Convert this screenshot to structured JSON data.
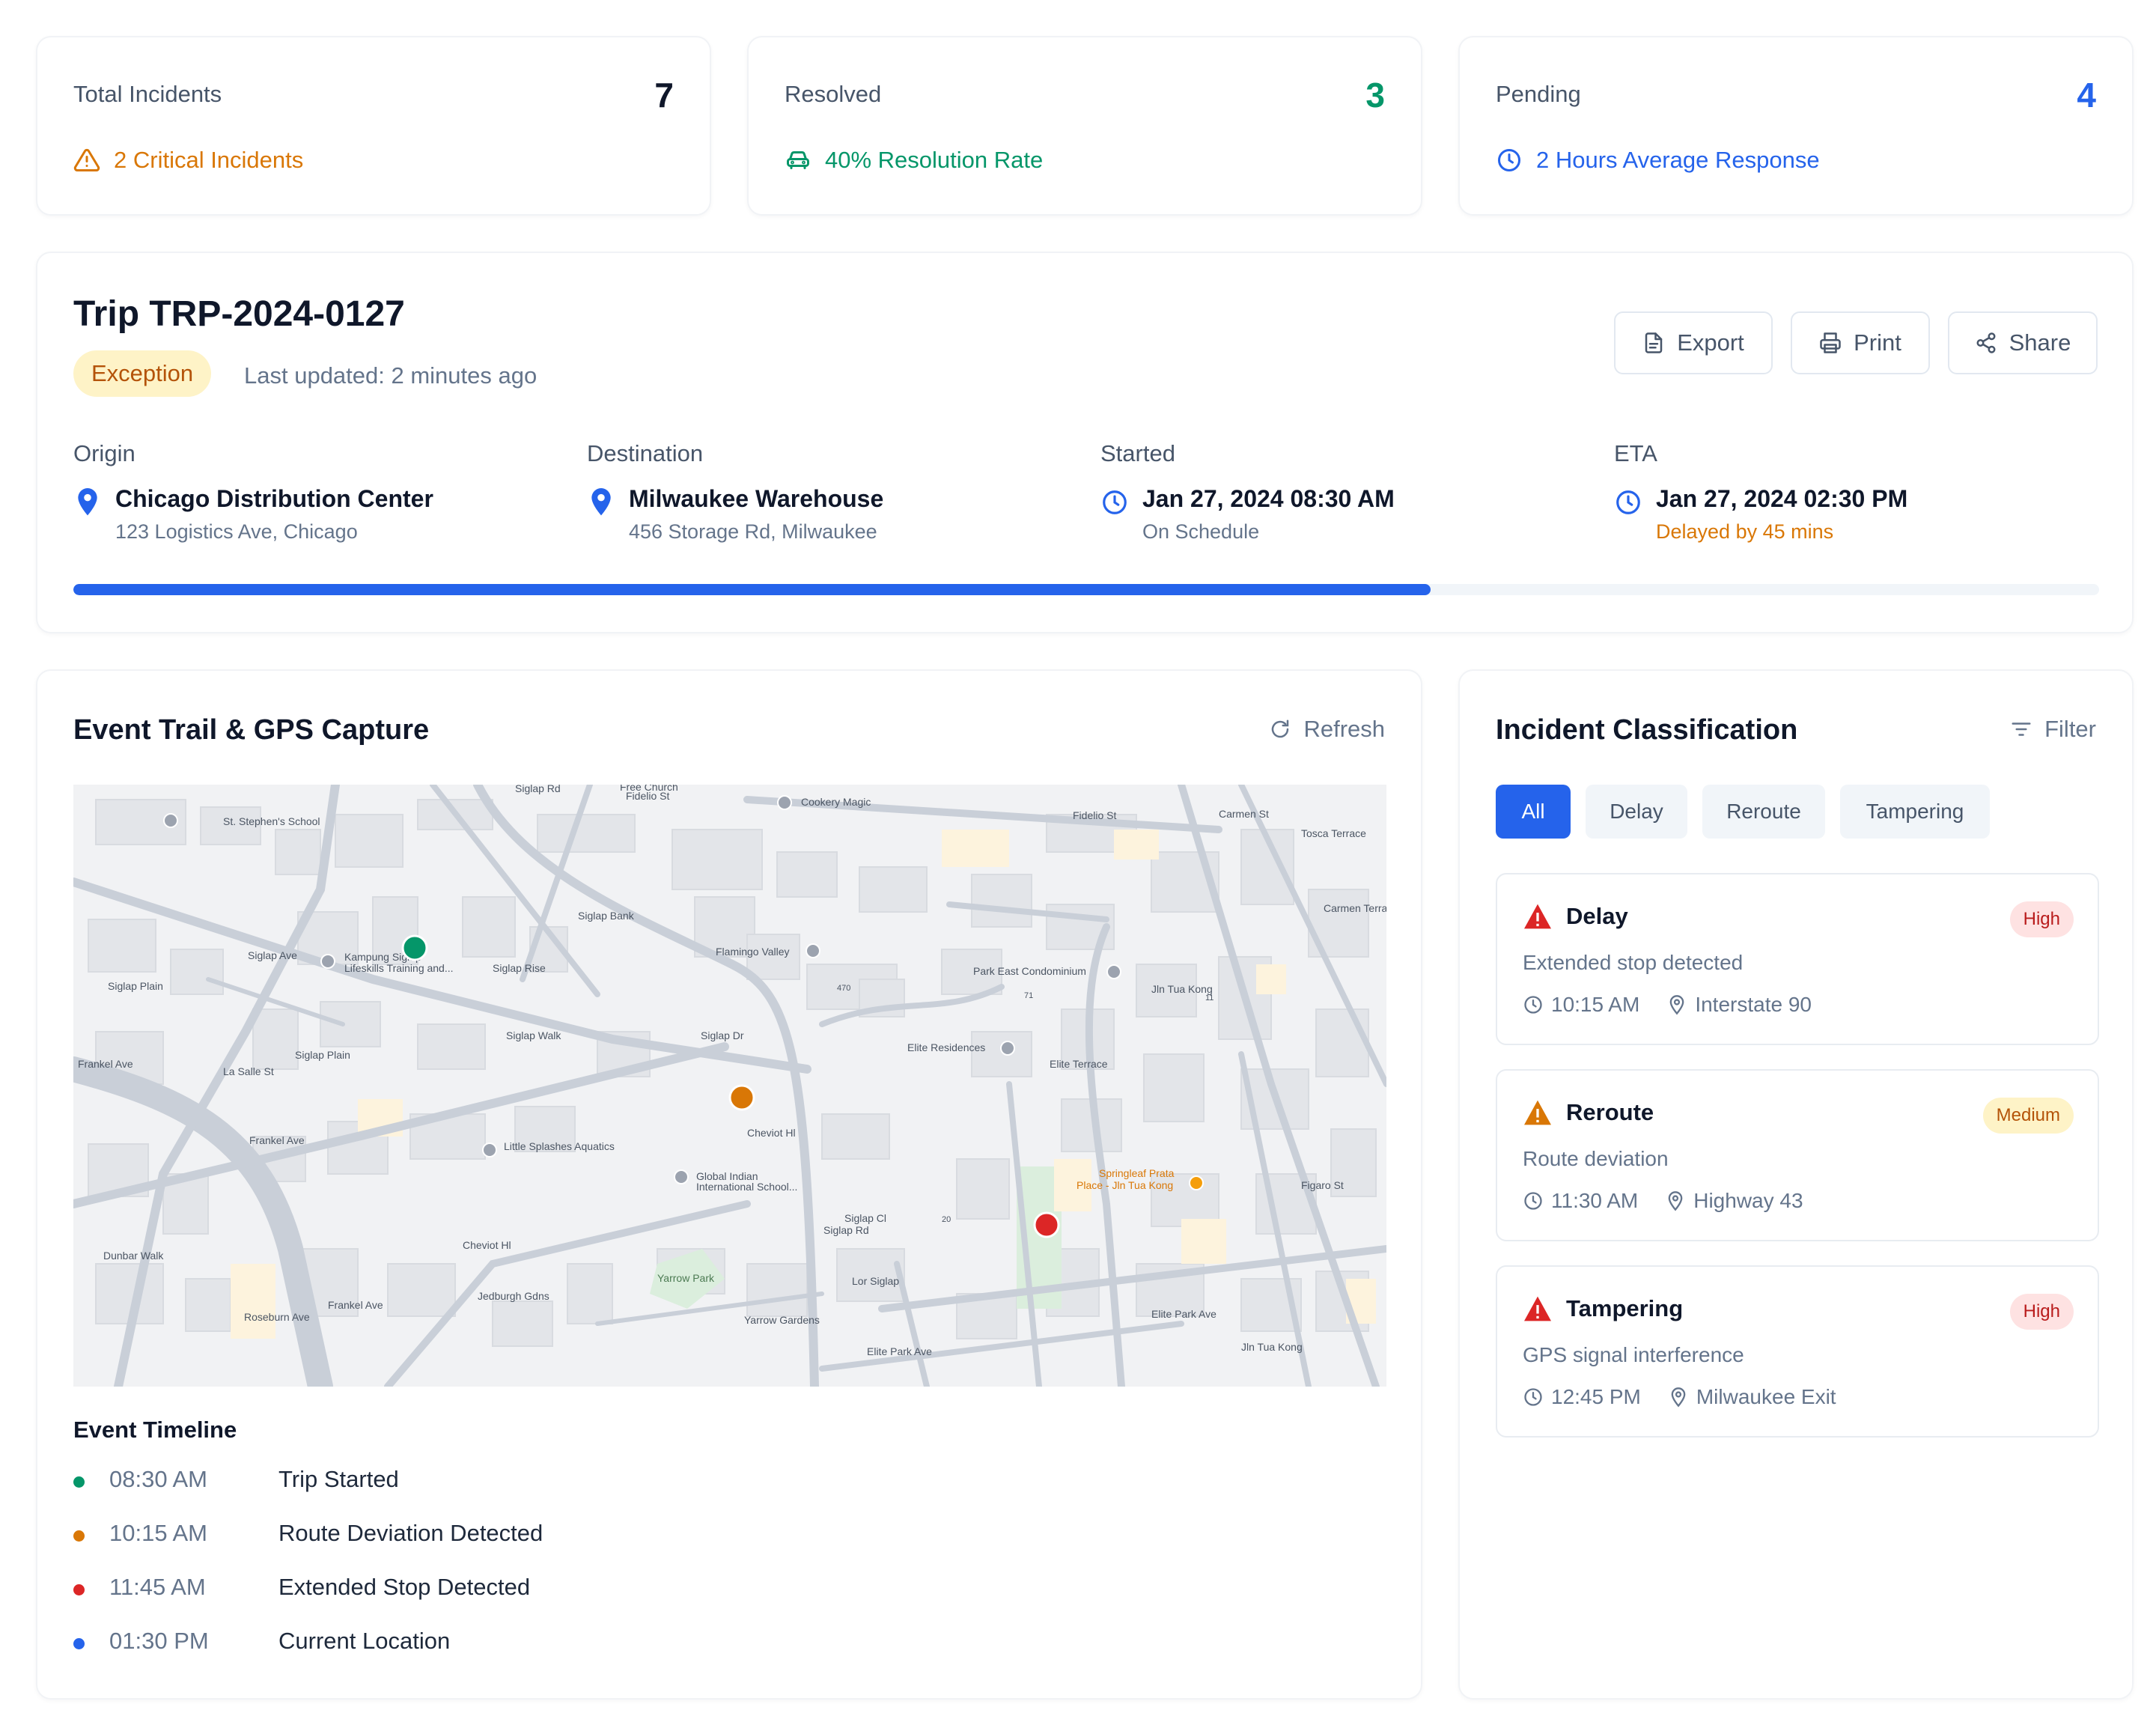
{
  "kpis": {
    "total": {
      "label": "Total Incidents",
      "value": "7",
      "sub": "2 Critical Incidents",
      "color": "#0f172a",
      "sub_color": "#d97706",
      "icon": "warning-triangle-icon"
    },
    "resolved": {
      "label": "Resolved",
      "value": "3",
      "sub": "40% Resolution Rate",
      "color": "#059669",
      "sub_color": "#059669",
      "icon": "car-icon"
    },
    "pending": {
      "label": "Pending",
      "value": "4",
      "sub": "2 Hours Average Response",
      "color": "#2563eb",
      "sub_color": "#2563eb",
      "icon": "clock-icon"
    }
  },
  "trip": {
    "title": "Trip TRP-2024-0127",
    "status": "Exception",
    "last_updated": "Last updated: 2 minutes ago",
    "buttons": {
      "export": "Export",
      "print": "Print",
      "share": "Share"
    },
    "origin": {
      "label": "Origin",
      "name": "Chicago Distribution Center",
      "sub": "123 Logistics Ave, Chicago"
    },
    "destination": {
      "label": "Destination",
      "name": "Milwaukee Warehouse",
      "sub": "456 Storage Rd, Milwaukee"
    },
    "started": {
      "label": "Started",
      "value": "Jan 27, 2024 08:30 AM",
      "sub": "On Schedule"
    },
    "eta": {
      "label": "ETA",
      "value": "Jan 27, 2024 02:30 PM",
      "sub": "Delayed by 45 mins"
    },
    "progress_percent": 67
  },
  "event_trail": {
    "title": "Event Trail & GPS Capture",
    "refresh": "Refresh",
    "map_labels": {
      "free_church": "Free Church",
      "cookery_magic": "Cookery Magic",
      "st_stephens": "St. Stephen's School",
      "fidelio_st": "Fidelio St",
      "fidelio_st_2": "Fidelio St",
      "siglap_rd": "Siglap Rd",
      "siglap_rd_2": "Siglap Rd",
      "siglap_ave": "Siglap Ave",
      "siglap_plain": "Siglap Plain",
      "siglap_plain_2": "Siglap Plain",
      "kampung_1": "Kampung Siglap",
      "kampung_2": "Lifeskills Training and...",
      "flamingo": "Flamingo Valley",
      "park_east": "Park East Condominium",
      "elite_res": "Elite Residences",
      "frankel_ave": "Frankel Ave",
      "frankel_ave_2": "Frankel Ave",
      "frankel_ave_3": "Frankel Ave",
      "la_salle": "La Salle St",
      "little_splashes": "Little Splashes Aquatics",
      "global_indian_1": "Global Indian",
      "global_indian_2": "International School...",
      "springleaf_1": "Springleaf Prata",
      "springleaf_2": "Place - Jln Tua Kong",
      "yarrow_park": "Yarrow Park",
      "siglap_cl": "Siglap Cl",
      "lor_siglap": "Lor Siglap",
      "elite_park_ave": "Elite Park Ave",
      "elite_park_ave_2": "Elite Park Ave",
      "cheviot_hl": "Cheviot Hl",
      "cheviot_hl_2": "Cheviot Hl",
      "dunbar_walk": "Dunbar Walk",
      "roseburn_ave": "Roseburn Ave",
      "jedburgh": "Jedburgh Gdns",
      "carmen_st": "Carmen St",
      "tosca_terrace": "Tosca Terrace",
      "carmen_terrace": "Carmen Terrace",
      "jln_tua_kong": "Jln Tua Kong",
      "jln_tua_kong_2": "Jln Tua Kong",
      "elite_terrace": "Elite Terrace",
      "figaro_st": "Figaro St",
      "siglap_bank": "Siglap Bank",
      "siglap_rise": "Siglap Rise",
      "siglap_walk": "Siglap Walk",
      "siglap_dr": "Siglap Dr",
      "yarrow_gardens": "Yarrow Gardens",
      "n470": "470",
      "n71": "71",
      "n11": "11",
      "n20": "20"
    },
    "timeline_title": "Event Timeline",
    "timeline": [
      {
        "time": "08:30 AM",
        "text": "Trip Started",
        "color": "#059669"
      },
      {
        "time": "10:15 AM",
        "text": "Route Deviation Detected",
        "color": "#d97706"
      },
      {
        "time": "11:45 AM",
        "text": "Extended Stop Detected",
        "color": "#dc2626"
      },
      {
        "time": "01:30 PM",
        "text": "Current Location",
        "color": "#2563eb"
      }
    ]
  },
  "classification": {
    "title": "Incident Classification",
    "filter": "Filter",
    "tabs": [
      "All",
      "Delay",
      "Reroute",
      "Tampering"
    ],
    "active_tab": "All",
    "incidents": [
      {
        "title": "Delay",
        "severity": "High",
        "desc": "Extended stop detected",
        "time": "10:15 AM",
        "location": "Interstate 90",
        "icon_color": "#dc2626"
      },
      {
        "title": "Reroute",
        "severity": "Medium",
        "desc": "Route deviation",
        "time": "11:30 AM",
        "location": "Highway 43",
        "icon_color": "#d97706"
      },
      {
        "title": "Tampering",
        "severity": "High",
        "desc": "GPS signal interference",
        "time": "12:45 PM",
        "location": "Milwaukee Exit",
        "icon_color": "#dc2626"
      }
    ]
  }
}
